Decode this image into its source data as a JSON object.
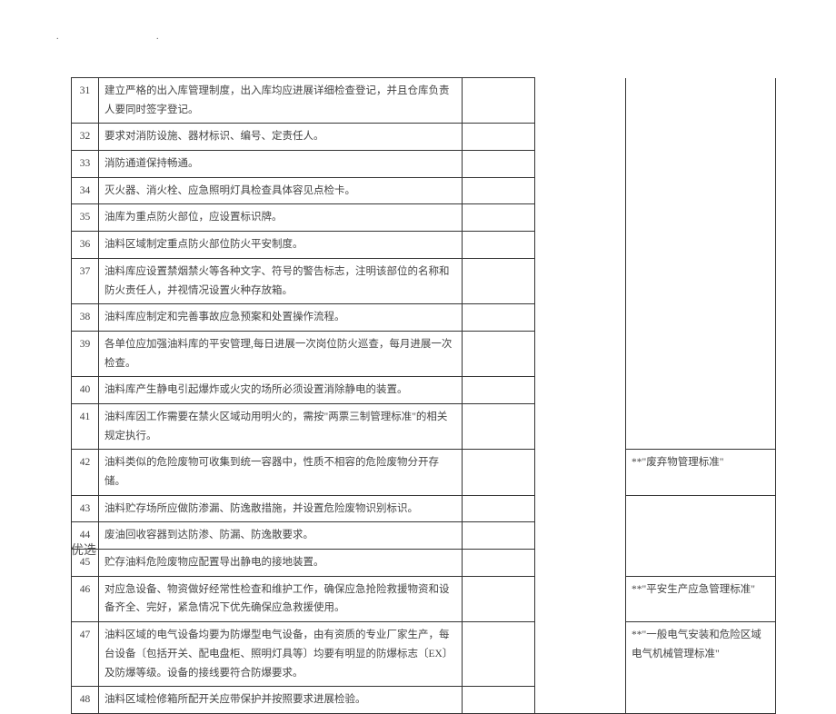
{
  "rows": [
    {
      "num": "31",
      "desc": "建立严格的出入库管理制度，出入库均应进展详细检查登记，并且仓库负责人要同时签字登记。",
      "note": ""
    },
    {
      "num": "32",
      "desc": "要求对消防设施、器材标识、编号、定责任人。",
      "note": ""
    },
    {
      "num": "33",
      "desc": "消防通道保持畅通。",
      "note": ""
    },
    {
      "num": "34",
      "desc": "灭火器、消火栓、应急照明灯具检查具体容见点检卡。",
      "note": ""
    },
    {
      "num": "35",
      "desc": "油库为重点防火部位，应设置标识牌。",
      "note": ""
    },
    {
      "num": "36",
      "desc": "油料区域制定重点防火部位防火平安制度。",
      "note": ""
    },
    {
      "num": "37",
      "desc": "油料库应设置禁烟禁火等各种文字、符号的警告标志，注明该部位的名称和防火责任人，并视情况设置火种存放箱。",
      "note": ""
    },
    {
      "num": "38",
      "desc": "油料库应制定和完善事故应急预案和处置操作流程。",
      "note": ""
    },
    {
      "num": "39",
      "desc": "各单位应加强油料库的平安管理,每日进展一次岗位防火巡查，每月进展一次检查。",
      "note": ""
    },
    {
      "num": "40",
      "desc": "油料库产生静电引起爆炸或火灾的场所必须设置消除静电的装置。",
      "note": ""
    },
    {
      "num": "41",
      "desc": "油料库因工作需要在禁火区域动用明火的，需按\"两票三制管理标准\"的相关规定执行。",
      "note": ""
    },
    {
      "num": "42",
      "desc": "油料类似的危险废物可收集到统一容器中，性质不相容的危险废物分开存储。",
      "note": "**\"废弃物管理标准\""
    },
    {
      "num": "43",
      "desc": "油料贮存场所应做防渗漏、防逸散措施，并设置危险废物识别标识。",
      "note": ""
    },
    {
      "num": "44",
      "desc": "废油回收容器到达防渗、防漏、防逸散要求。",
      "note": ""
    },
    {
      "num": "45",
      "desc": "贮存油料危险废物应配置导出静电的接地装置。",
      "note": ""
    },
    {
      "num": "46",
      "desc": "对应急设备、物资做好经常性检查和维护工作，确保应急抢险救援物资和设备齐全、完好，紧急情况下优先确保应急救援使用。",
      "note": "**\"平安生产应急管理标准\""
    },
    {
      "num": "47",
      "desc": "油料区域的电气设备均要为防爆型电气设备，由有资质的专业厂家生产，每台设备〔包括开关、配电盘柜、照明灯具等〕均要有明显的防爆标志〔EX〕及防爆等级。设备的接线要符合防爆要求。",
      "note": "**\"一般电气安装和危险区域电气机械管理标准\""
    },
    {
      "num": "48",
      "desc": "油料区域检修箱所配开关应带保护并按照要求进展检验。",
      "note": ""
    }
  ],
  "footer": "优选"
}
